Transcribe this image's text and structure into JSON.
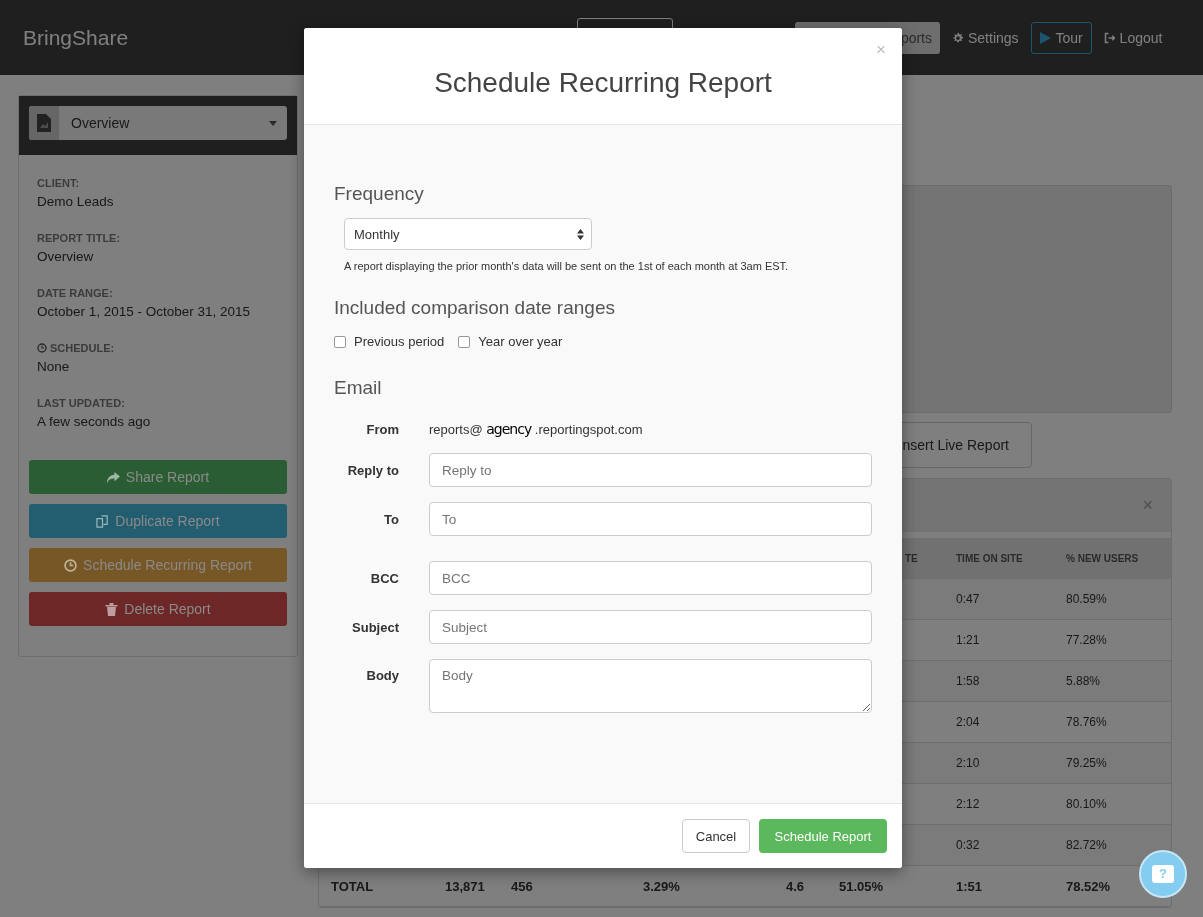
{
  "navbar": {
    "brand": "BringShare",
    "reports_button": "ports",
    "settings": "Settings",
    "tour": "Tour",
    "logout": "Logout"
  },
  "sidebar": {
    "report_select": "Overview",
    "info": [
      {
        "label": "CLIENT:",
        "value": "Demo Leads",
        "kind": "plain"
      },
      {
        "label": "REPORT TITLE:",
        "value": "Overview",
        "kind": "plain"
      },
      {
        "label": "DATE RANGE:",
        "value": "October 1, 2015 - October 31, 2015",
        "kind": "plain"
      },
      {
        "label": "SCHEDULE:",
        "value": "None",
        "kind": "clock"
      },
      {
        "label": "LAST UPDATED:",
        "value": "A few seconds ago",
        "kind": "plain"
      }
    ],
    "buttons": [
      {
        "label": "Share Report",
        "kind": "share",
        "color": "#2b5d35"
      },
      {
        "label": "Duplicate Report",
        "kind": "duplicate",
        "color": "#235d70"
      },
      {
        "label": "Schedule Recurring Report",
        "kind": "clock",
        "color": "#775726"
      },
      {
        "label": "Delete Report",
        "kind": "trash",
        "color": "#6d2727"
      }
    ]
  },
  "main": {
    "insert_button": "nsert Live Report",
    "table": {
      "close": "×",
      "columns": [
        "",
        "",
        "",
        "",
        "",
        "TE",
        "TIME ON SITE",
        "% NEW USERS"
      ],
      "rows": [
        [
          "",
          "",
          "",
          "",
          "",
          "",
          "0:47",
          "80.59%"
        ],
        [
          "",
          "",
          "",
          "",
          "",
          "",
          "1:21",
          "77.28%"
        ],
        [
          "",
          "",
          "",
          "",
          "",
          "",
          "1:58",
          "5.88%"
        ],
        [
          "",
          "",
          "",
          "",
          "",
          "",
          "2:04",
          "78.76%"
        ],
        [
          "",
          "",
          "",
          "",
          "",
          "",
          "2:10",
          "79.25%"
        ],
        [
          "",
          "",
          "",
          "",
          "",
          "",
          "2:12",
          "80.10%"
        ],
        [
          "",
          "",
          "",
          "",
          "",
          "",
          "0:32",
          "82.72%"
        ]
      ],
      "total": [
        "TOTAL",
        "13,871",
        "456",
        "3.29%",
        "4.6",
        "51.05%",
        "1:51",
        "78.52%"
      ]
    }
  },
  "help_button": {
    "label": "?"
  },
  "modal": {
    "title": "Schedule Recurring Report",
    "close": "×",
    "frequency": {
      "heading": "Frequency",
      "value": "Monthly",
      "help": "A report displaying the prior month's data will be sent on the 1st of each month at 3am EST."
    },
    "comparison": {
      "heading": "Included comparison date ranges",
      "options": [
        {
          "label": "Previous period",
          "checked": false
        },
        {
          "label": "Year over year",
          "checked": false
        }
      ]
    },
    "email": {
      "heading": "Email",
      "from_label": "From",
      "from": [
        "reports@",
        "agency",
        ".reportingspot.com"
      ],
      "fields": [
        {
          "label": "Reply to",
          "placeholder": "Reply to",
          "kind": "input"
        },
        {
          "label": "To",
          "placeholder": "To",
          "kind": "input"
        },
        {
          "label": "BCC",
          "placeholder": "BCC",
          "kind": "input"
        },
        {
          "label": "Subject",
          "placeholder": "Subject",
          "kind": "input"
        },
        {
          "label": "Body",
          "placeholder": "Body",
          "kind": "textarea"
        }
      ]
    },
    "buttons": {
      "cancel": "Cancel",
      "submit": "Schedule Report"
    }
  }
}
